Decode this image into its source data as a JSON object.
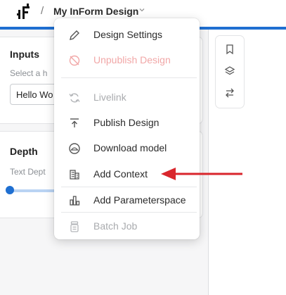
{
  "header": {
    "breadcrumb_separator": "/",
    "title": "My InForm Design"
  },
  "inputs_panel": {
    "title": "Inputs",
    "subtitle": "Select a h",
    "input_value": "Hello Wo"
  },
  "depth_panel": {
    "title": "Depth",
    "subtitle": "Text Dept",
    "slider_value": 0.0
  },
  "menu": {
    "items": [
      {
        "label": "Design Settings",
        "icon": "pencil-icon",
        "state": "enabled"
      },
      {
        "label": "Unpublish Design",
        "icon": "unpublish-icon",
        "state": "danger-disabled"
      },
      {
        "label": "Livelink",
        "icon": "sync-icon",
        "state": "disabled"
      },
      {
        "label": "Publish Design",
        "icon": "upload-icon",
        "state": "enabled"
      },
      {
        "label": "Download model",
        "icon": "download-cloud-icon",
        "state": "enabled"
      },
      {
        "label": "Add Context",
        "icon": "buildings-icon",
        "state": "enabled"
      },
      {
        "label": "Add Parameterspace",
        "icon": "bar-chart-icon",
        "state": "enabled"
      },
      {
        "label": "Batch Job",
        "icon": "batch-icon",
        "state": "disabled"
      }
    ]
  },
  "colors": {
    "accent": "#1f6fd1",
    "annotation_arrow": "#d9262c",
    "danger_text": "#f1a7a7"
  }
}
